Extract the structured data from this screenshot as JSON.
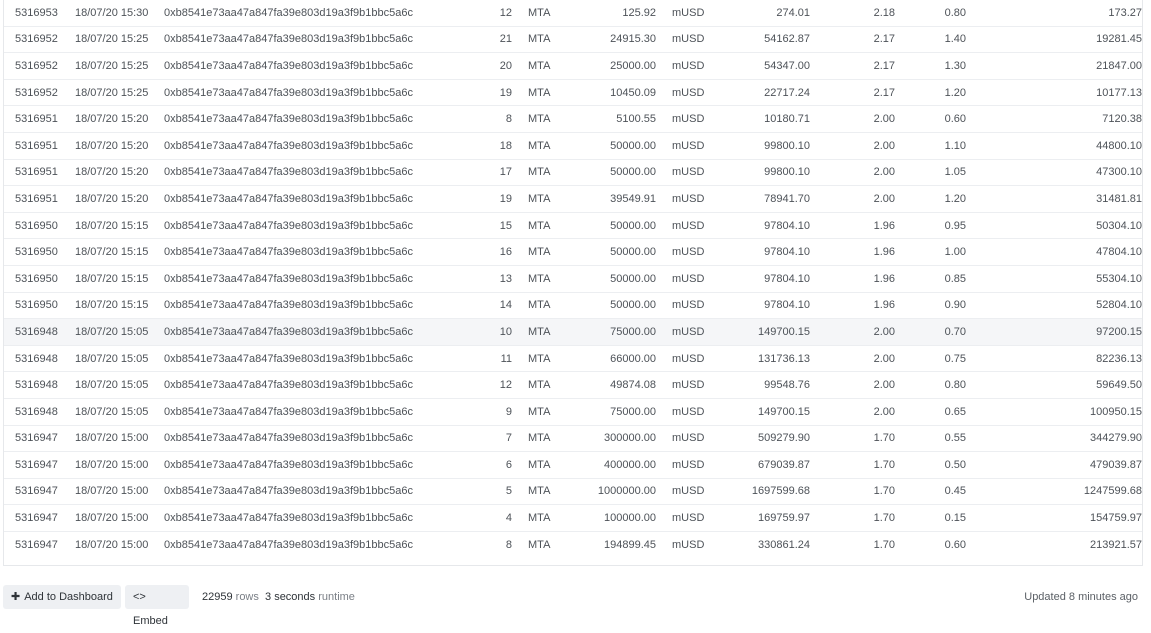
{
  "rows": [
    [
      "5316953",
      "18/07/20 15:30",
      "0xb8541e73aa47a847fa39e803d19a3f9b1bbc5a6c",
      "12",
      "MTA",
      "125.92",
      "mUSD",
      "274.01",
      "2.18",
      "0.80",
      "173.27"
    ],
    [
      "5316952",
      "18/07/20 15:25",
      "0xb8541e73aa47a847fa39e803d19a3f9b1bbc5a6c",
      "21",
      "MTA",
      "24915.30",
      "mUSD",
      "54162.87",
      "2.17",
      "1.40",
      "19281.45"
    ],
    [
      "5316952",
      "18/07/20 15:25",
      "0xb8541e73aa47a847fa39e803d19a3f9b1bbc5a6c",
      "20",
      "MTA",
      "25000.00",
      "mUSD",
      "54347.00",
      "2.17",
      "1.30",
      "21847.00"
    ],
    [
      "5316952",
      "18/07/20 15:25",
      "0xb8541e73aa47a847fa39e803d19a3f9b1bbc5a6c",
      "19",
      "MTA",
      "10450.09",
      "mUSD",
      "22717.24",
      "2.17",
      "1.20",
      "10177.13"
    ],
    [
      "5316951",
      "18/07/20 15:20",
      "0xb8541e73aa47a847fa39e803d19a3f9b1bbc5a6c",
      "8",
      "MTA",
      "5100.55",
      "mUSD",
      "10180.71",
      "2.00",
      "0.60",
      "7120.38"
    ],
    [
      "5316951",
      "18/07/20 15:20",
      "0xb8541e73aa47a847fa39e803d19a3f9b1bbc5a6c",
      "18",
      "MTA",
      "50000.00",
      "mUSD",
      "99800.10",
      "2.00",
      "1.10",
      "44800.10"
    ],
    [
      "5316951",
      "18/07/20 15:20",
      "0xb8541e73aa47a847fa39e803d19a3f9b1bbc5a6c",
      "17",
      "MTA",
      "50000.00",
      "mUSD",
      "99800.10",
      "2.00",
      "1.05",
      "47300.10"
    ],
    [
      "5316951",
      "18/07/20 15:20",
      "0xb8541e73aa47a847fa39e803d19a3f9b1bbc5a6c",
      "19",
      "MTA",
      "39549.91",
      "mUSD",
      "78941.70",
      "2.00",
      "1.20",
      "31481.81"
    ],
    [
      "5316950",
      "18/07/20 15:15",
      "0xb8541e73aa47a847fa39e803d19a3f9b1bbc5a6c",
      "15",
      "MTA",
      "50000.00",
      "mUSD",
      "97804.10",
      "1.96",
      "0.95",
      "50304.10"
    ],
    [
      "5316950",
      "18/07/20 15:15",
      "0xb8541e73aa47a847fa39e803d19a3f9b1bbc5a6c",
      "16",
      "MTA",
      "50000.00",
      "mUSD",
      "97804.10",
      "1.96",
      "1.00",
      "47804.10"
    ],
    [
      "5316950",
      "18/07/20 15:15",
      "0xb8541e73aa47a847fa39e803d19a3f9b1bbc5a6c",
      "13",
      "MTA",
      "50000.00",
      "mUSD",
      "97804.10",
      "1.96",
      "0.85",
      "55304.10"
    ],
    [
      "5316950",
      "18/07/20 15:15",
      "0xb8541e73aa47a847fa39e803d19a3f9b1bbc5a6c",
      "14",
      "MTA",
      "50000.00",
      "mUSD",
      "97804.10",
      "1.96",
      "0.90",
      "52804.10"
    ],
    [
      "5316948",
      "18/07/20 15:05",
      "0xb8541e73aa47a847fa39e803d19a3f9b1bbc5a6c",
      "10",
      "MTA",
      "75000.00",
      "mUSD",
      "149700.15",
      "2.00",
      "0.70",
      "97200.15"
    ],
    [
      "5316948",
      "18/07/20 15:05",
      "0xb8541e73aa47a847fa39e803d19a3f9b1bbc5a6c",
      "11",
      "MTA",
      "66000.00",
      "mUSD",
      "131736.13",
      "2.00",
      "0.75",
      "82236.13"
    ],
    [
      "5316948",
      "18/07/20 15:05",
      "0xb8541e73aa47a847fa39e803d19a3f9b1bbc5a6c",
      "12",
      "MTA",
      "49874.08",
      "mUSD",
      "99548.76",
      "2.00",
      "0.80",
      "59649.50"
    ],
    [
      "5316948",
      "18/07/20 15:05",
      "0xb8541e73aa47a847fa39e803d19a3f9b1bbc5a6c",
      "9",
      "MTA",
      "75000.00",
      "mUSD",
      "149700.15",
      "2.00",
      "0.65",
      "100950.15"
    ],
    [
      "5316947",
      "18/07/20 15:00",
      "0xb8541e73aa47a847fa39e803d19a3f9b1bbc5a6c",
      "7",
      "MTA",
      "300000.00",
      "mUSD",
      "509279.90",
      "1.70",
      "0.55",
      "344279.90"
    ],
    [
      "5316947",
      "18/07/20 15:00",
      "0xb8541e73aa47a847fa39e803d19a3f9b1bbc5a6c",
      "6",
      "MTA",
      "400000.00",
      "mUSD",
      "679039.87",
      "1.70",
      "0.50",
      "479039.87"
    ],
    [
      "5316947",
      "18/07/20 15:00",
      "0xb8541e73aa47a847fa39e803d19a3f9b1bbc5a6c",
      "5",
      "MTA",
      "1000000.00",
      "mUSD",
      "1697599.68",
      "1.70",
      "0.45",
      "1247599.68"
    ],
    [
      "5316947",
      "18/07/20 15:00",
      "0xb8541e73aa47a847fa39e803d19a3f9b1bbc5a6c",
      "4",
      "MTA",
      "100000.00",
      "mUSD",
      "169759.97",
      "1.70",
      "0.15",
      "154759.97"
    ],
    [
      "5316947",
      "18/07/20 15:00",
      "0xb8541e73aa47a847fa39e803d19a3f9b1bbc5a6c",
      "8",
      "MTA",
      "194899.45",
      "mUSD",
      "330861.24",
      "1.70",
      "0.60",
      "213921.57"
    ]
  ],
  "highlighted_row": 12,
  "footer": {
    "add_to_dashboard_icon": "plus-icon",
    "add_to_dashboard_label": "Add to Dashboard",
    "embed_icon": "code-icon",
    "embed_label": "Embed",
    "row_count": "22959",
    "row_count_suffix": "rows",
    "runtime": "3 seconds",
    "runtime_suffix": "runtime",
    "updated": "Updated 8 minutes ago"
  }
}
